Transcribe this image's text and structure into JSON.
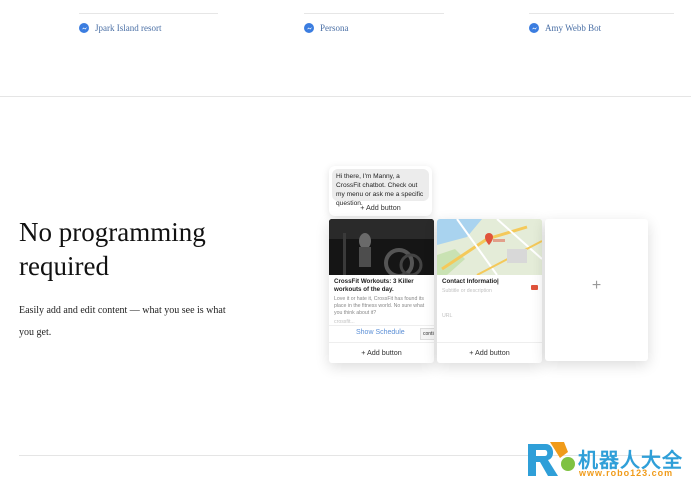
{
  "top_bots": [
    {
      "label": "Jpark Island resort",
      "icon": "messenger-icon"
    },
    {
      "label": "Persona",
      "icon": "messenger-icon"
    },
    {
      "label": "Amy Webb Bot",
      "icon": "messenger-icon"
    }
  ],
  "feature": {
    "title_line1": "No programming",
    "title_line2": "required",
    "description_line1": "Easily add and edit content — what you see is what",
    "description_line2": "you get."
  },
  "mockup": {
    "bubble_text": "Hi there, I'm Manny, a CrossFit chatbot. Check out my menu or ask me a specific question.",
    "add_button_label": "+ Add button",
    "card1": {
      "title": "CrossFit Workouts: 3 Killer workouts of the day.",
      "subtitle": "Love it or hate it, CrossFit has found its place in the fitness world. No sure what you think about it?",
      "url_hint": "crossfit...",
      "action_label": "Show Schedule",
      "tag_label": "contin",
      "add_button_label": "+ Add button"
    },
    "card2": {
      "title": "Contact Informatio|",
      "subtitle": "Subtitle or description",
      "url_hint": "URL",
      "add_button_label": "+ Add button"
    },
    "card3": {
      "plus_label": "+"
    }
  },
  "watermark": {
    "brand_text": "机器人大全",
    "url": "www.robo123.com",
    "colors": {
      "blue": "#2f9fd8",
      "orange": "#f09b1a"
    }
  },
  "colors": {
    "link": "#4a6fa5",
    "messenger": "#3b7de0",
    "action": "#5b8fd6"
  }
}
